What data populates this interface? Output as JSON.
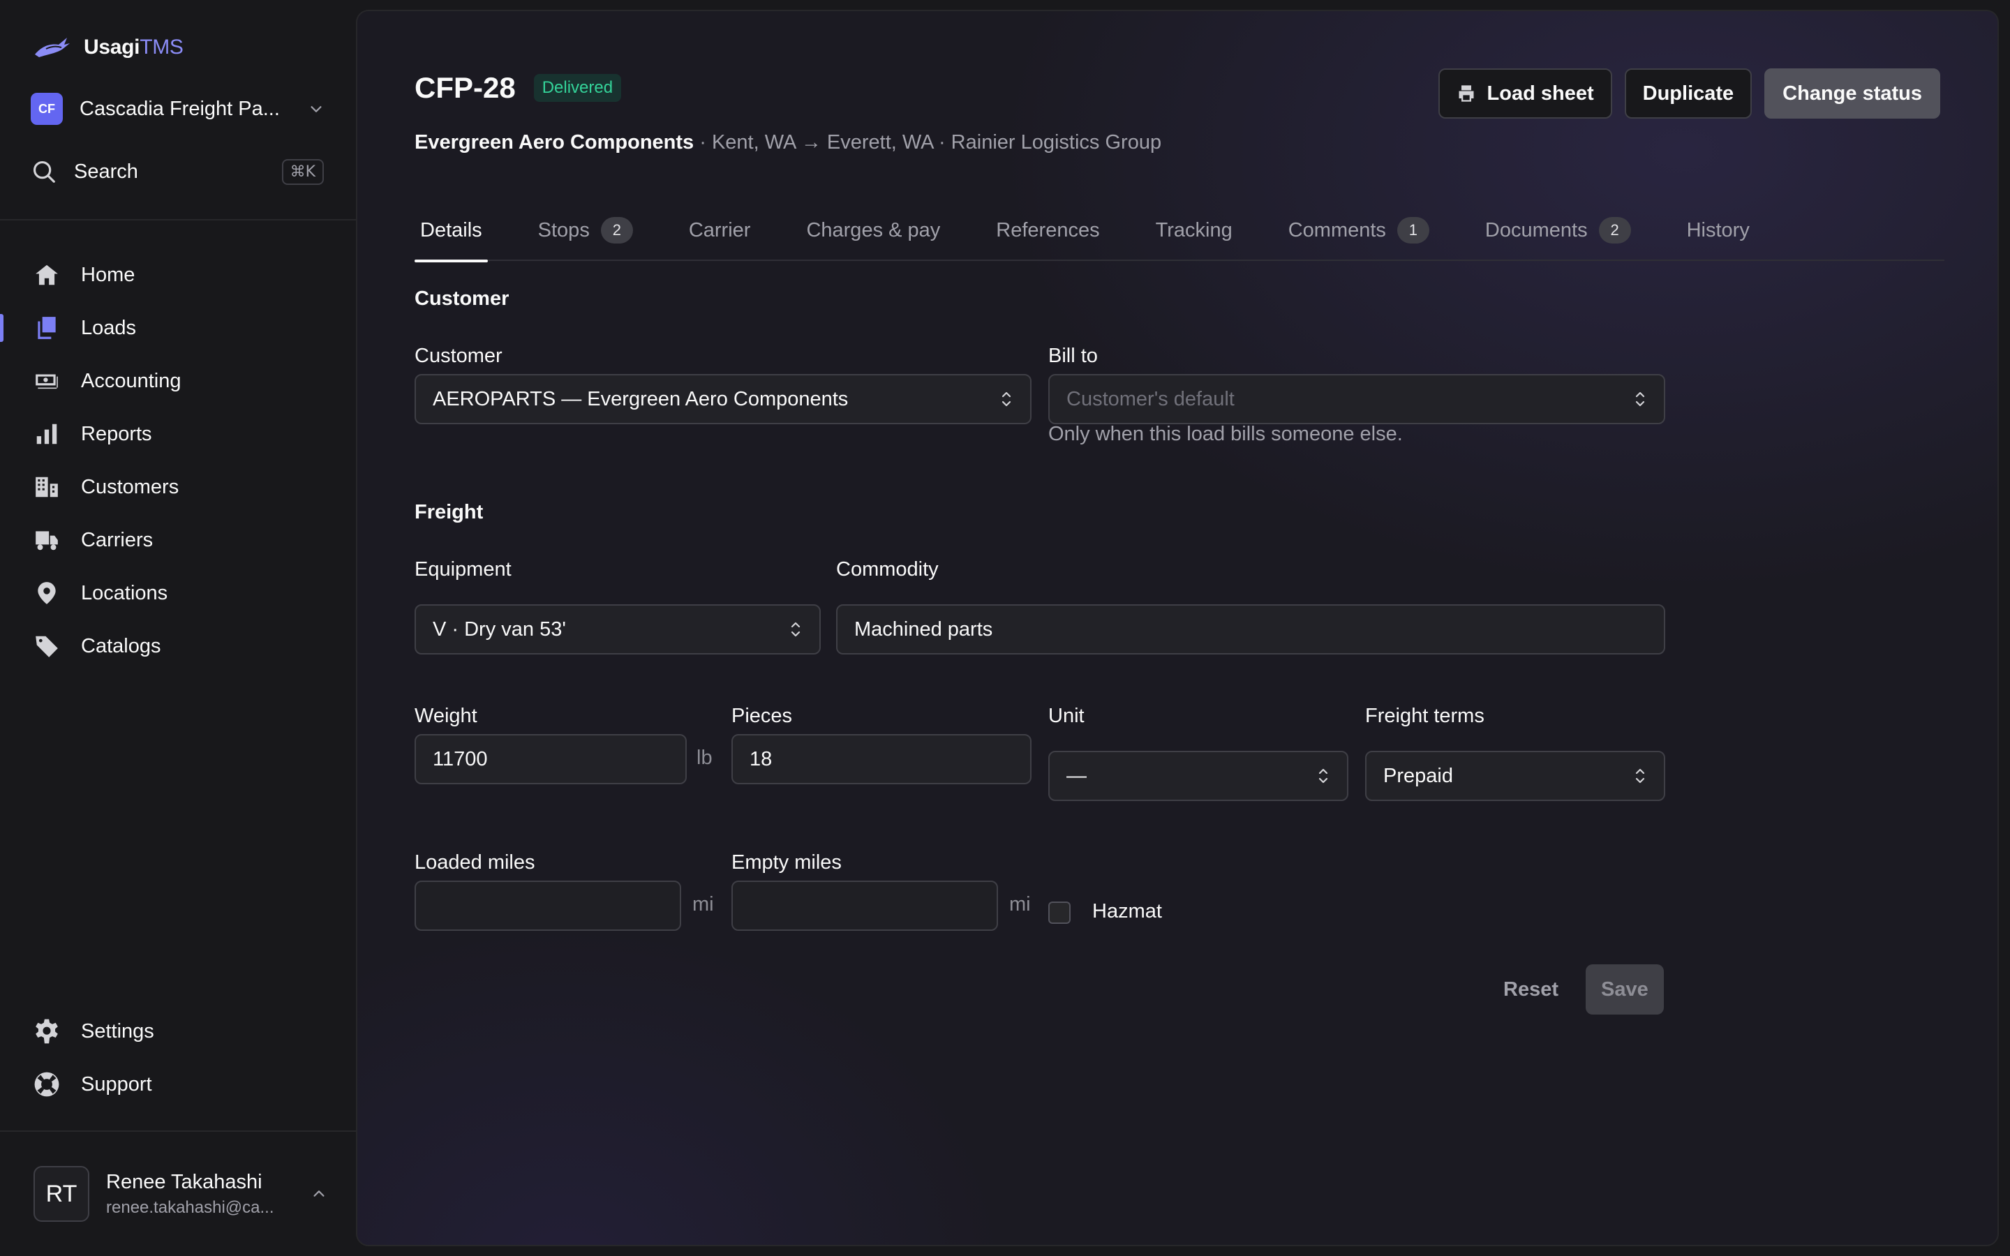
{
  "brand": {
    "name_primary": "Usagi",
    "name_secondary": "TMS"
  },
  "org": {
    "initials": "CF",
    "name": "Cascadia Freight Pa..."
  },
  "search": {
    "label": "Search",
    "shortcut": "⌘K"
  },
  "nav": {
    "items": [
      {
        "label": "Home",
        "icon": "home-icon",
        "active": false
      },
      {
        "label": "Loads",
        "icon": "loads-icon",
        "active": true
      },
      {
        "label": "Accounting",
        "icon": "accounting-icon",
        "active": false
      },
      {
        "label": "Reports",
        "icon": "reports-icon",
        "active": false
      },
      {
        "label": "Customers",
        "icon": "customers-icon",
        "active": false
      },
      {
        "label": "Carriers",
        "icon": "carriers-icon",
        "active": false
      },
      {
        "label": "Locations",
        "icon": "location-icon",
        "active": false
      },
      {
        "label": "Catalogs",
        "icon": "tag-icon",
        "active": false
      }
    ],
    "bottom": [
      {
        "label": "Settings",
        "icon": "gear-icon"
      },
      {
        "label": "Support",
        "icon": "lifebuoy-icon"
      }
    ]
  },
  "user": {
    "initials": "RT",
    "name": "Renee Takahashi",
    "email": "renee.takahashi@ca..."
  },
  "load": {
    "id": "CFP-28",
    "status": "Delivered",
    "customer_name": "Evergreen Aero Components",
    "route": " · Kent, WA → Everett, WA · Rainier Logistics Group"
  },
  "actions": {
    "load_sheet": "Load sheet",
    "duplicate": "Duplicate",
    "change_status": "Change status"
  },
  "tabs": [
    {
      "label": "Details",
      "count": null,
      "active": true
    },
    {
      "label": "Stops",
      "count": "2",
      "active": false
    },
    {
      "label": "Carrier",
      "count": null,
      "active": false
    },
    {
      "label": "Charges & pay",
      "count": null,
      "active": false
    },
    {
      "label": "References",
      "count": null,
      "active": false
    },
    {
      "label": "Tracking",
      "count": null,
      "active": false
    },
    {
      "label": "Comments",
      "count": "1",
      "active": false
    },
    {
      "label": "Documents",
      "count": "2",
      "active": false
    },
    {
      "label": "History",
      "count": null,
      "active": false
    }
  ],
  "customer_section": {
    "title": "Customer",
    "customer_label": "Customer",
    "customer_value": "AEROPARTS — Evergreen Aero Components",
    "bill_to_label": "Bill to",
    "bill_to_placeholder": "Customer's default",
    "bill_to_hint": "Only when this load bills someone else."
  },
  "freight_section": {
    "title": "Freight",
    "equipment_label": "Equipment",
    "equipment_value": "V · Dry van 53'",
    "commodity_label": "Commodity",
    "commodity_value": "Machined parts",
    "weight_label": "Weight",
    "weight_value": "11700",
    "weight_unit": "lb",
    "pieces_label": "Pieces",
    "pieces_value": "18",
    "unit_label": "Unit",
    "unit_value": "—",
    "terms_label": "Freight terms",
    "terms_value": "Prepaid",
    "loaded_miles_label": "Loaded miles",
    "loaded_miles_value": "",
    "empty_miles_label": "Empty miles",
    "empty_miles_value": "",
    "miles_unit": "mi",
    "hazmat_label": "Hazmat",
    "hazmat_checked": false
  },
  "form_actions": {
    "reset": "Reset",
    "save": "Save"
  }
}
